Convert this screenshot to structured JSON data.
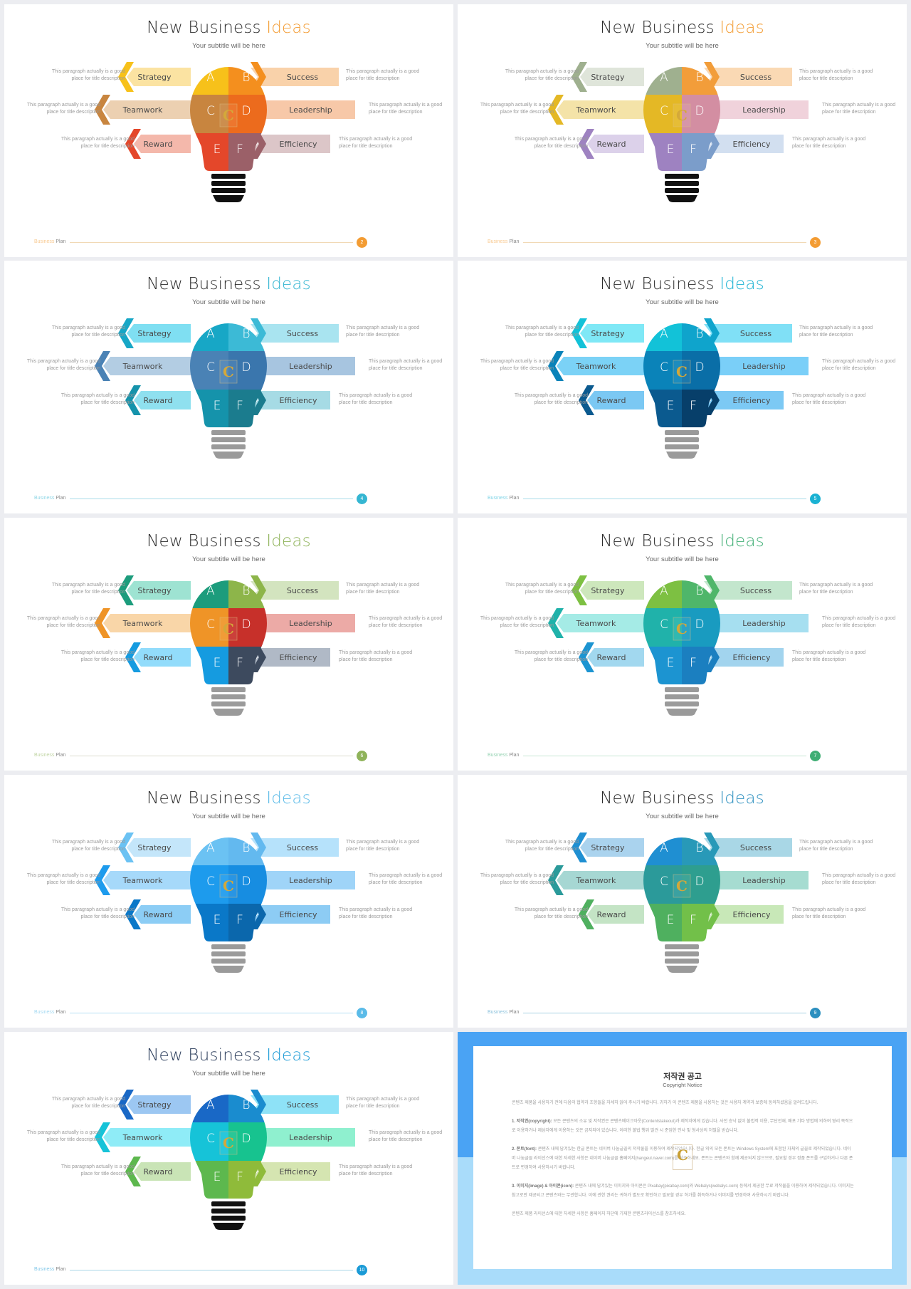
{
  "slide_common": {
    "title_main": "New Business Ideas",
    "title_part1": "New Business ",
    "title_accent": "Ideas",
    "subtitle": "Your subtitle will be here",
    "footer_word1": "Business",
    "footer_word2": "Plan",
    "description": "This paragraph actually is a good place for title description",
    "items": [
      {
        "letter": "A",
        "label": "Strategy",
        "side": "left"
      },
      {
        "letter": "B",
        "label": "Success",
        "side": "right"
      },
      {
        "letter": "C",
        "label": "Teamwork",
        "side": "left"
      },
      {
        "letter": "D",
        "label": "Leadership",
        "side": "right"
      },
      {
        "letter": "E",
        "label": "Reward",
        "side": "left"
      },
      {
        "letter": "F",
        "label": "Efficiency",
        "side": "right"
      }
    ],
    "logo_letter": "C"
  },
  "slides": [
    {
      "page": "2",
      "accent": "#f39c33",
      "title_color": "#2b2b2b",
      "base": "#111111",
      "footer_line": "#f1d9b5",
      "colors": [
        "#f7c11a",
        "#f48f1e",
        "#c8853f",
        "#ec6b1d",
        "#e4472a",
        "#9b6068"
      ],
      "arrow_light": [
        "#fbe3a2",
        "#f9d2aa",
        "#ecd0b1",
        "#f7c8a8",
        "#f4b8ab",
        "#dcc6c8"
      ]
    },
    {
      "page": "3",
      "accent": "#f39c33",
      "title_color": "#2b2b2b",
      "base": "#111111",
      "footer_line": "#f1d9b5",
      "colors": [
        "#9fb08f",
        "#f29d3a",
        "#e4b825",
        "#d38ea2",
        "#9e82c1",
        "#7b9dca"
      ],
      "arrow_light": [
        "#dfe5da",
        "#fad9b4",
        "#f4e3a8",
        "#f0d2db",
        "#dcd1ea",
        "#d2dff0"
      ]
    },
    {
      "page": "4",
      "accent": "#35b6d2",
      "title_color": "#2b2b2b",
      "base": "#9a9a9a",
      "footer_line": "#a9dde9",
      "colors": [
        "#17a7c6",
        "#3cbad6",
        "#4a82b5",
        "#3a76ad",
        "#1593ab",
        "#1b7c8e"
      ],
      "arrow_light": [
        "#7fdff2",
        "#a9e4f0",
        "#b3cde3",
        "#a7c5e0",
        "#8fe0ef",
        "#a6dbe5"
      ]
    },
    {
      "page": "5",
      "accent": "#1ab2d3",
      "title_color": "#2b2b2b",
      "base": "#9a9a9a",
      "footer_line": "#a9dde9",
      "colors": [
        "#12c2d8",
        "#0fa4cc",
        "#0a83b9",
        "#0a6ea7",
        "#0b5a8f",
        "#073f6a"
      ],
      "arrow_light": [
        "#7fe8f6",
        "#80e0f6",
        "#7bd2f6",
        "#7acff8",
        "#7bc8f3",
        "#7cc9f4"
      ]
    },
    {
      "page": "6",
      "accent": "#8fb35a",
      "title_color": "#2b2b2b",
      "base": "#9a9a9a",
      "footer_line": "#dcdccf",
      "colors": [
        "#1c9c7c",
        "#8db54a",
        "#ef9427",
        "#c7302a",
        "#159be0",
        "#3d4a5e"
      ],
      "arrow_light": [
        "#9ee3d2",
        "#d3e4bf",
        "#f9d6a8",
        "#ecaaa6",
        "#92dcfb",
        "#b0b9c6"
      ]
    },
    {
      "page": "7",
      "accent": "#3fae74",
      "title_color": "#2b2b2b",
      "base": "#9a9a9a",
      "footer_line": "#c8e8d4",
      "colors": [
        "#7dc042",
        "#4fb66a",
        "#20b2aa",
        "#199bc0",
        "#1c94d1",
        "#1b7fc0"
      ],
      "arrow_light": [
        "#cde7bc",
        "#c3e6cd",
        "#a5ebe6",
        "#a6dff0",
        "#a2d8ef",
        "#a2d4ee"
      ]
    },
    {
      "page": "8",
      "accent": "#5bbbe8",
      "title_color": "#2b2b2b",
      "base": "#9a9a9a",
      "footer_line": "#b7e0f4",
      "colors": [
        "#6bc2f3",
        "#63b9ef",
        "#1d9bed",
        "#178de1",
        "#0a78c8",
        "#0b67ac"
      ],
      "arrow_light": [
        "#c4e6fa",
        "#b6e2fb",
        "#a6d9fa",
        "#9fd4f8",
        "#8ccdf5",
        "#8dccf4"
      ]
    },
    {
      "page": "9",
      "accent": "#2b8fbf",
      "title_color": "#2b2b2b",
      "base": "#9a9a9a",
      "footer_line": "#a9d2e3",
      "colors": [
        "#1f8fd2",
        "#2899b8",
        "#2b9a9a",
        "#2e9e8f",
        "#4fb05f",
        "#72c049"
      ],
      "arrow_light": [
        "#aad3ee",
        "#a9d7e6",
        "#a6d7d3",
        "#a6dcd1",
        "#c4e4c5",
        "#c8e8b8"
      ]
    },
    {
      "page": "10",
      "accent": "#1a9ad6",
      "title_color": "#2a3c5a",
      "base": "#111111",
      "footer_line": "#a9d6e6",
      "colors": [
        "#1968c6",
        "#1a8ccf",
        "#16c3d8",
        "#17c38f",
        "#5db84e",
        "#8fbb3a"
      ],
      "arrow_light": [
        "#9cc7f2",
        "#8ee2f7",
        "#8fecf7",
        "#8ff0cf",
        "#c9e4b6",
        "#d5e5b1"
      ]
    }
  ],
  "copyright": {
    "title": "저작권 공고",
    "subtitle": "Copyright Notice",
    "intro": "콘텐츠 제품을 사용하기 전에 다음의 협약과 조항들을 자세히 읽어 주시기 바랍니다. 귀하가 이 콘텐츠 제품을 사용하는 것은 사용자 계약과 보증에 동의하셨음을 알려드립니다.",
    "sections": [
      {
        "heading": "1. 저작권(copyright):",
        "text": "모든 콘텐츠의 소유 및 저작권은 콘텐츠메이크아웃(Contentstakeout)과 제작자에게 있습니다. 사전 승낙 없이 불법적 이용, 무단전재, 배포 기타 방법에 의하여 영리 목적으로 이용하거나 제삼자에게 이용하는 것은 금지되어 있습니다. 이러한 불법 행위 발견 시 준엄한 민사 및 형사상의 처벌을 받습니다."
      },
      {
        "heading": "2. 폰트(font):",
        "text": "콘텐츠 내에 담겨있는 한글 폰트는 네이버 나눔글꼴의 저작물을 이용하여 제작되었습니다. 한글 외의 모든 폰트는 Windows System에 포함된 자체의 글꼴로 제작되었습니다. 네이버 나눔글꼴 라이선스에 대한 자세한 사항은 네이버 나눔글꼴 홈페이지(hangeul.naver.com)를 참조하세요. 폰트는 콘텐츠와 함께 제공되지 않으므로, 필요할 경우 정품 폰트를 구입하거나 다른 폰트로 변경하여 사용하시기 바랍니다."
      },
      {
        "heading": "3. 이미지(image) & 아이콘(icon):",
        "text": "콘텐츠 내에 담겨있는 이미지와 아이콘은 Pixabay(pixabay.com)와 Webalys(webalys.com) 등에서 제공한 무료 저작물을 이용하여 제작되었습니다. 이미지는 참고로만 제공되고 콘텐츠와는 무관합니다. 이에 관한 권리는 귀하가 별도로 확인하고 필요할 경우 허가를 취득하거나 이미지를 변경하여 사용하시기 바랍니다."
      }
    ],
    "outro": "콘텐츠 제품 라이선스에 대한 자세한 사항은 홈페이지 하단에 기재한 콘텐츠라이선스를 참조하세요."
  }
}
